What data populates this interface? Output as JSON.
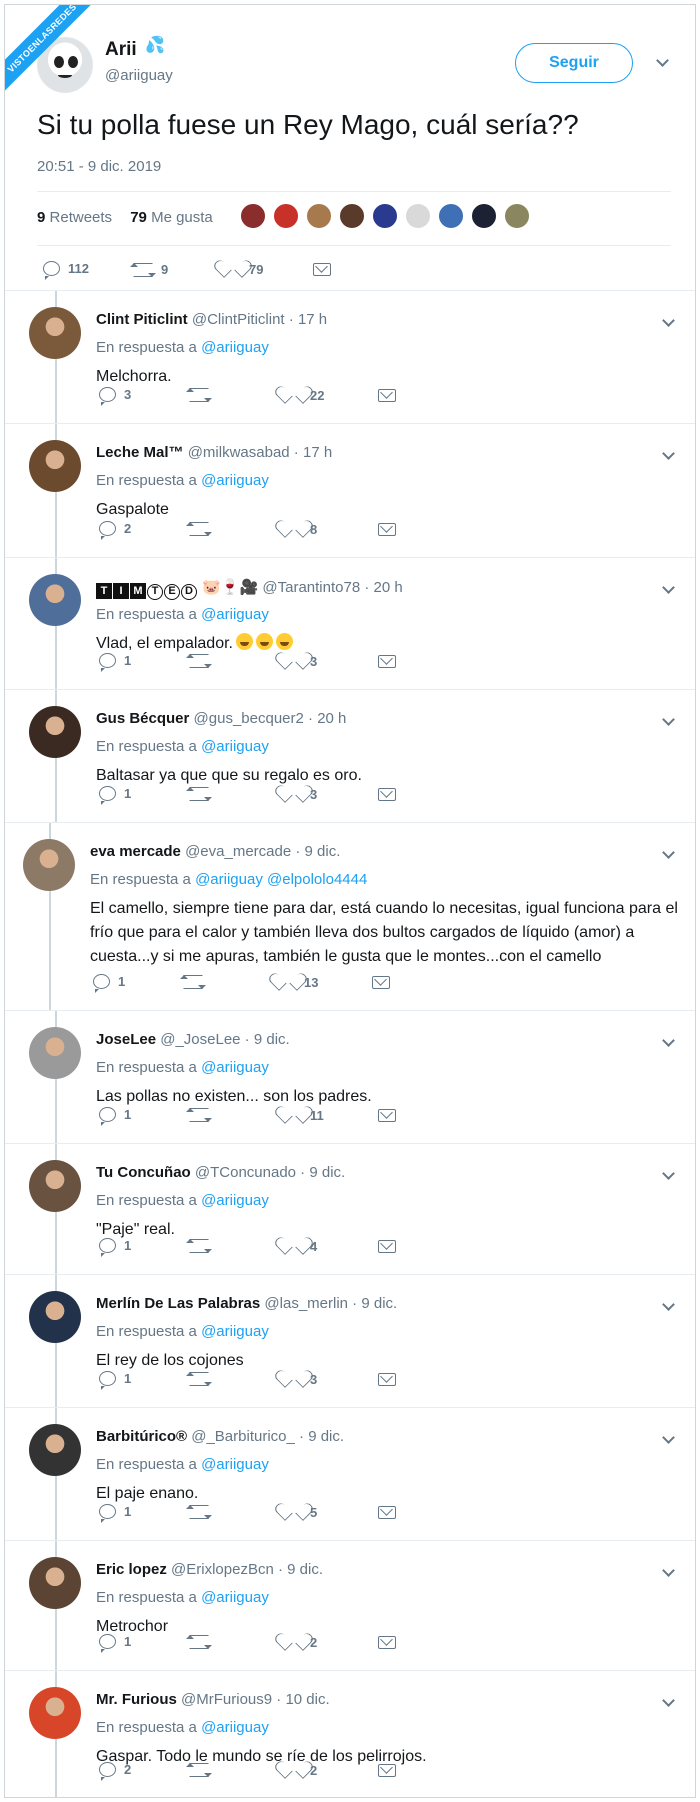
{
  "watermark": "VISTOENLASREDES",
  "main_tweet": {
    "name": "Arii",
    "handle": "@ariiguay",
    "follow_label": "Seguir",
    "text": "Si tu polla fuese un Rey Mago, cuál sería??",
    "timestamp": "20:51 - 9 dic. 2019",
    "retweets_count": "9",
    "retweets_label": "Retweets",
    "likes_count": "79",
    "likes_label": "Me gusta",
    "replies": "112",
    "retweets": "9",
    "likes": "79"
  },
  "in_reply_label": "En respuesta a",
  "replies": [
    {
      "name": "Clint Piticlint",
      "handle": "@ClintPiticlint",
      "time": "17 h",
      "to": "@ariiguay",
      "to2": "",
      "text": "Melchorra.",
      "replies": "3",
      "retweets": "",
      "likes": "22"
    },
    {
      "name": "Leche Mal™",
      "handle": "@milkwasabad",
      "time": "17 h",
      "to": "@ariiguay",
      "to2": "",
      "text": "Gaspalote",
      "replies": "2",
      "retweets": "",
      "likes": "8"
    },
    {
      "name": "🅣🅘🅜🅣🅔🅓",
      "handle": "@Tarantinto78",
      "time": "20 h",
      "to": "@ariiguay",
      "to2": "",
      "text": "Vlad, el empalador.",
      "replies": "1",
      "retweets": "",
      "likes": "3"
    },
    {
      "name": "Gus Bécquer",
      "handle": "@gus_becquer2",
      "time": "20 h",
      "to": "@ariiguay",
      "to2": "",
      "text": "Baltasar ya que que su regalo es oro.",
      "replies": "1",
      "retweets": "",
      "likes": "3"
    },
    {
      "name": "eva mercade",
      "handle": "@eva_mercade",
      "time": "9 dic.",
      "to": "@ariiguay",
      "to2": "@elpololo4444",
      "text": "El camello, siempre tiene para dar, está cuando lo necesitas, igual funciona para el frío que para el calor y también lleva dos bultos cargados de líquido (amor) a cuesta...y si me apuras, también le gusta que le montes...con el camello",
      "replies": "1",
      "retweets": "",
      "likes": "13"
    },
    {
      "name": "JoseLee",
      "handle": "@_JoseLee",
      "time": "9 dic.",
      "to": "@ariiguay",
      "to2": "",
      "text": "Las pollas no existen... son los padres.",
      "replies": "1",
      "retweets": "",
      "likes": "11"
    },
    {
      "name": "Tu Concuñao",
      "handle": "@TConcunado",
      "time": "9 dic.",
      "to": "@ariiguay",
      "to2": "",
      "text": "\"Paje\" real.",
      "replies": "1",
      "retweets": "",
      "likes": "4"
    },
    {
      "name": "Merlín De Las Palabras",
      "handle": "@las_merlin",
      "time": "9 dic.",
      "to": "@ariiguay",
      "to2": "",
      "text": "El rey de los cojones",
      "replies": "1",
      "retweets": "",
      "likes": "3"
    },
    {
      "name": "Barbitúrico®",
      "handle": "@_Barbiturico_",
      "time": "9 dic.",
      "to": "@ariiguay",
      "to2": "",
      "text": "El paje enano.",
      "replies": "1",
      "retweets": "",
      "likes": "5"
    },
    {
      "name": "Eric lopez",
      "handle": "@ErixlopezBcn",
      "time": "9 dic.",
      "to": "@ariiguay",
      "to2": "",
      "text": "Metrochor",
      "replies": "1",
      "retweets": "",
      "likes": "2"
    },
    {
      "name": "Mr. Furious",
      "handle": "@MrFurious9",
      "time": "10 dic.",
      "to": "@ariiguay",
      "to2": "",
      "text": "Gaspar. Todo le mundo se ríe de los pelirrojos.",
      "replies": "2",
      "retweets": "",
      "likes": "2"
    }
  ]
}
